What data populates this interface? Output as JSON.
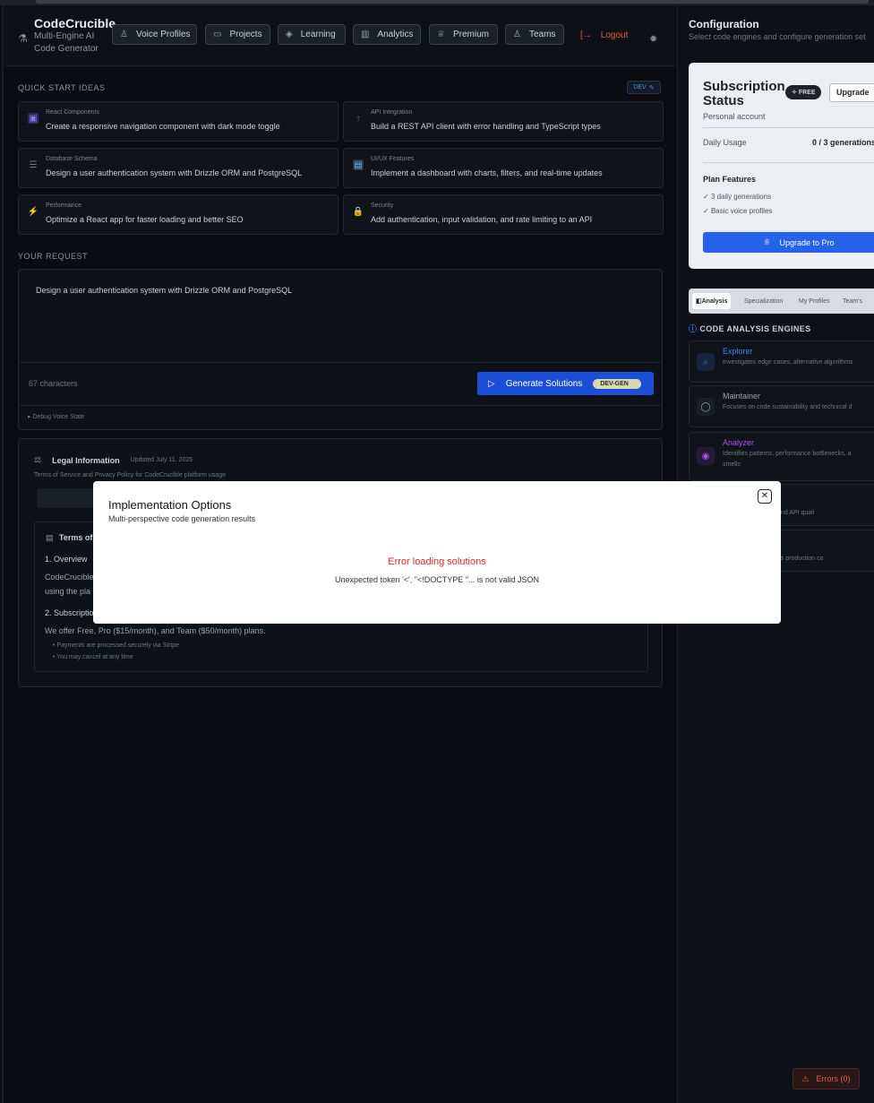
{
  "header": {
    "app_name": "CodeCrucible",
    "tagline_1": "Multi-Engine AI",
    "tagline_2": "Code Generator",
    "nav": [
      {
        "label": "Voice Profiles",
        "icon": "user-icon"
      },
      {
        "label": "Projects",
        "icon": "folder-icon"
      },
      {
        "label": "Learning",
        "icon": "graduation-cap-icon"
      },
      {
        "label": "Analytics",
        "icon": "bar-chart-icon"
      },
      {
        "label": "Premium",
        "icon": "crown-icon"
      },
      {
        "label": "Teams",
        "icon": "users-icon"
      }
    ],
    "logout": "Logout"
  },
  "quick_start": {
    "title": "QUICK START IDEAS",
    "dev_badge": "DEV",
    "ideas": [
      {
        "category": "React Components",
        "text": "Create a responsive navigation component with dark mode toggle",
        "icon": "component-icon"
      },
      {
        "category": "API Integration",
        "text": "Build a REST API client with error handling and TypeScript types",
        "icon": "plug-icon"
      },
      {
        "category": "Database Schema",
        "text": "Design a user authentication system with Drizzle ORM and PostgreSQL",
        "icon": "database-icon"
      },
      {
        "category": "UI/UX Features",
        "text": "Implement a dashboard with charts, filters, and real-time updates",
        "icon": "chart-icon"
      },
      {
        "category": "Performance",
        "text": "Optimize a React app for faster loading and better SEO",
        "icon": "lightning-icon"
      },
      {
        "category": "Security",
        "text": "Add authentication, input validation, and rate limiting to an API",
        "icon": "lock-icon"
      }
    ]
  },
  "request": {
    "title": "YOUR REQUEST",
    "text": "Design a user authentication system with Drizzle ORM and PostgreSQL",
    "char_count": "67 characters",
    "generate_label": "Generate Solutions",
    "generate_tag": "DEV-GEN",
    "debug_label": "Debug Voice State"
  },
  "legal": {
    "title": "Legal Information",
    "updated": "Updated July 11, 2025",
    "subtitle": "Terms of Service and Privacy Policy for CodeCrucible platform usage",
    "terms_title": "Terms of",
    "overview_head": "1. Overview",
    "overview_line1": "CodeCrucible",
    "overview_line2": "using the pla",
    "subs_head": "2. Subscriptio",
    "subs_text": "We offer Free, Pro ($15/month), and Team ($50/month) plans.",
    "bullets": [
      "Payments are processed securely via Stripe",
      "You may cancel at any time"
    ]
  },
  "sidebar": {
    "title": "Configuration",
    "subtitle": "Select code engines and configure generation set",
    "subscription": {
      "title": "Subscription Status",
      "badge": "FREE",
      "upgrade_small": "Upgrade",
      "account": "Personal account",
      "daily_usage_label": "Daily Usage",
      "daily_usage_value": "0 / 3 generations",
      "features_title": "Plan Features",
      "features": [
        "3 daily generations",
        "Basic voice profiles"
      ],
      "upgrade_pro": "Upgrade to Pro"
    },
    "tabs": [
      "Analysis",
      "Specialization",
      "My Profiles",
      "Team's"
    ],
    "engines_title": "CODE ANALYSIS ENGINES",
    "engines": [
      {
        "name": "Explorer",
        "desc": "Investigates edge cases, alternative algorithms",
        "color": "#3b82f6"
      },
      {
        "name": "Maintainer",
        "desc": "Focuses on code sustainability and technical d",
        "color": "#9aa3ad"
      },
      {
        "name": "Analyzer",
        "desc": "Identifies patterns, performance bottlenecks, a",
        "desc2": "smells",
        "color": "#a855f7"
      },
      {
        "name": "",
        "desc": "n experience and API quali",
        "color": "#6e7681"
      },
      {
        "name": "",
        "desc": "decisions, ships production co",
        "color": "#6e7681"
      }
    ]
  },
  "errors_button": "Errors (0)",
  "modal": {
    "title": "Implementation Options",
    "subtitle": "Multi-perspective code generation results",
    "error_title": "Error loading solutions",
    "error_detail": "Unexpected token '<', \"<!DOCTYPE \"... is not valid JSON"
  }
}
